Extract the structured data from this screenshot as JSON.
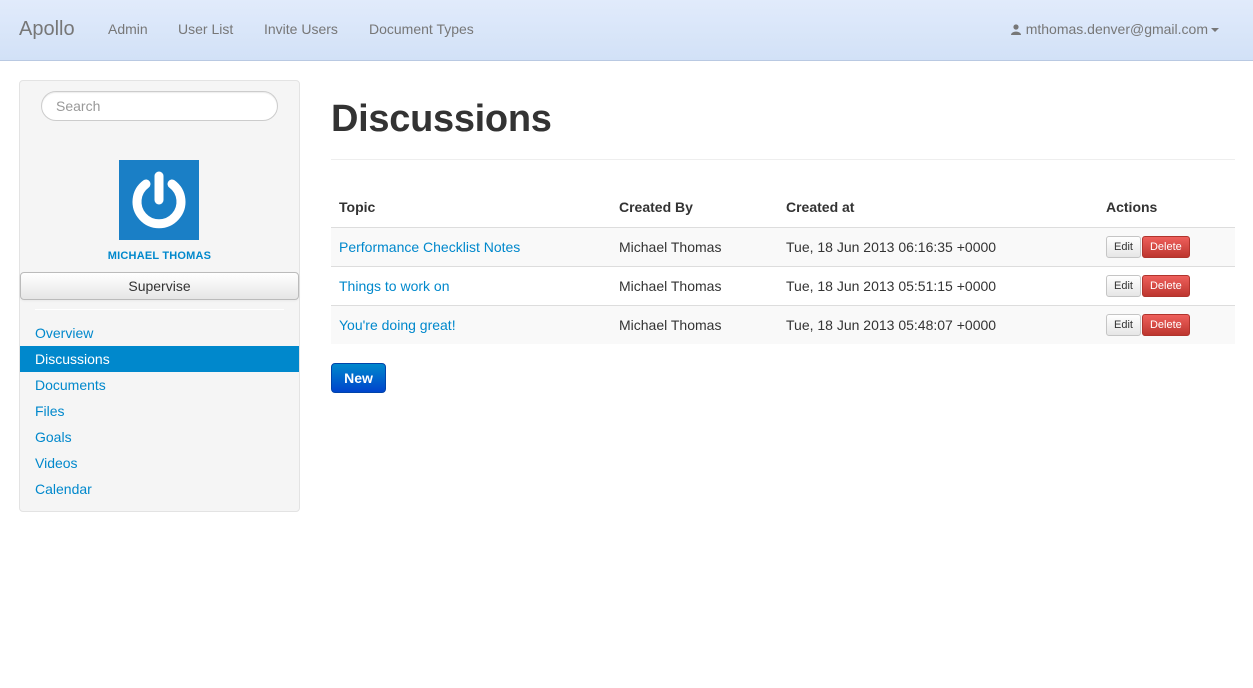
{
  "navbar": {
    "brand": "Apollo",
    "links": [
      "Admin",
      "User List",
      "Invite Users",
      "Document Types"
    ],
    "user_email": "mthomas.denver@gmail.com"
  },
  "sidebar": {
    "search_placeholder": "Search",
    "profile_name": "MICHAEL THOMAS",
    "supervise_label": "Supervise",
    "items": [
      "Overview",
      "Discussions",
      "Documents",
      "Files",
      "Goals",
      "Videos",
      "Calendar"
    ],
    "active_item": "Discussions"
  },
  "main": {
    "title": "Discussions",
    "table": {
      "headers": [
        "Topic",
        "Created By",
        "Created at",
        "Actions"
      ],
      "rows": [
        {
          "topic": "Performance Checklist Notes",
          "created_by": "Michael Thomas",
          "created_at": "Tue, 18 Jun 2013 06:16:35 +0000",
          "edit": "Edit",
          "delete": "Delete"
        },
        {
          "topic": "Things to work on",
          "created_by": "Michael Thomas",
          "created_at": "Tue, 18 Jun 2013 05:51:15 +0000",
          "edit": "Edit",
          "delete": "Delete"
        },
        {
          "topic": "You're doing great!",
          "created_by": "Michael Thomas",
          "created_at": "Tue, 18 Jun 2013 05:48:07 +0000",
          "edit": "Edit",
          "delete": "Delete"
        }
      ]
    },
    "new_label": "New"
  },
  "colors": {
    "navbar_bg": "#dbe7fa",
    "link": "#0088cc",
    "active_bg": "#0088cc",
    "danger": "#da4f49",
    "primary": "#0066cc",
    "avatar_bg": "#1a7fc6"
  },
  "icons": {
    "user": "user-icon",
    "caret": "caret-down-icon",
    "avatar": "power-icon"
  }
}
